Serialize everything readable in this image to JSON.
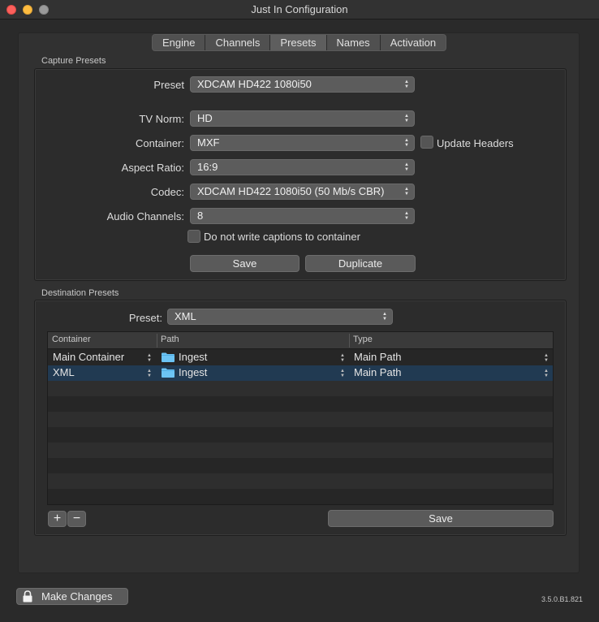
{
  "window": {
    "title": "Just In Configuration"
  },
  "tabs": [
    {
      "label": "Engine"
    },
    {
      "label": "Channels"
    },
    {
      "label": "Presets",
      "active": true
    },
    {
      "label": "Names"
    },
    {
      "label": "Activation"
    }
  ],
  "capture": {
    "group_label": "Capture Presets",
    "preset_label": "Preset",
    "preset_value": "XDCAM HD422 1080i50",
    "tv_norm_label": "TV Norm:",
    "tv_norm_value": "HD",
    "container_label": "Container:",
    "container_value": "MXF",
    "update_headers_label": "Update Headers",
    "update_headers_checked": false,
    "aspect_label": "Aspect Ratio:",
    "aspect_value": "16:9",
    "codec_label": "Codec:",
    "codec_value": "XDCAM HD422 1080i50 (50 Mb/s CBR)",
    "audio_label": "Audio Channels:",
    "audio_value": "8",
    "no_captions_label": "Do not write captions to container",
    "no_captions_checked": false,
    "save_label": "Save",
    "duplicate_label": "Duplicate"
  },
  "destination": {
    "group_label": "Destination Presets",
    "preset_label": "Preset:",
    "preset_value": "XML",
    "columns": [
      "Container",
      "Path",
      "Type"
    ],
    "rows": [
      {
        "container": "Main Container",
        "path": "Ingest",
        "type": "Main Path",
        "selected": false
      },
      {
        "container": "XML",
        "path": "Ingest",
        "type": "Main Path",
        "selected": true
      }
    ],
    "add_label": "+",
    "remove_label": "−",
    "save_label": "Save"
  },
  "footer": {
    "make_changes_label": "Make Changes",
    "version": "3.5.0.B1.821"
  },
  "colors": {
    "selection": "#213a52",
    "folder": "#6cc4f4",
    "close": "#fc605c",
    "minimize": "#fdbc40"
  }
}
